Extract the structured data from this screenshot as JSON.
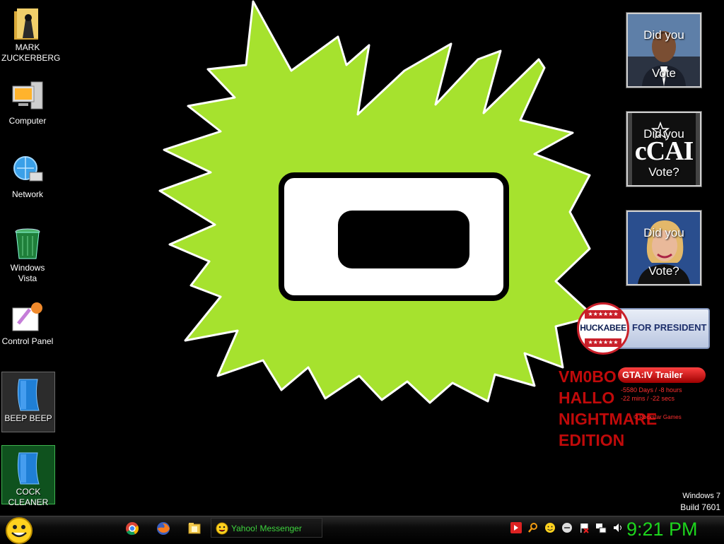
{
  "desktop_icons": [
    {
      "label": "MARK ZUCKERBERG",
      "icon": "user-folder-icon"
    },
    {
      "label": "Computer",
      "icon": "computer-icon"
    },
    {
      "label": "Network",
      "icon": "network-icon"
    },
    {
      "label": "Windows Vista",
      "icon": "recycle-bin-icon"
    },
    {
      "label": "Control Panel",
      "icon": "control-panel-icon"
    },
    {
      "label": "BEEP BEEP",
      "icon": "blue-document-icon"
    },
    {
      "label": "COCK CLEANER",
      "icon": "blue-document-icon"
    }
  ],
  "vote_gadgets": [
    {
      "line1": "Did you",
      "line2": "Vote",
      "image": "obama-photo"
    },
    {
      "line1": "Did you",
      "line2": "Vote?",
      "image": "ccai-logo",
      "logo_text": "cCAI"
    },
    {
      "line1": "Did you",
      "line2": "Vote?",
      "image": "hillary-photo"
    }
  ],
  "huckabee": {
    "name": "HUCKABEE",
    "tagline": "FOR PRESIDENT",
    "stars": "★★★★★★"
  },
  "red_text": [
    "VM0BO",
    "HALLO",
    "NIGHTMARE",
    "EDITION"
  ],
  "gta": {
    "title": "GTA:IV Trailer",
    "countdown1": "-5580 Days / -8 hours",
    "countdown2": "-22 mins / -22 secs",
    "credit": "© Rockstar Games"
  },
  "build": {
    "os": "Windows 7",
    "build": "Build 7601"
  },
  "taskbar": {
    "start_icon": "smiley-start-icon",
    "pinned": [
      "chrome-icon",
      "firefox-icon",
      "folder-icon"
    ],
    "running": {
      "label": "Yahoo! Messenger",
      "icon": "yahoo-smiley-icon"
    },
    "tray_icons": [
      "red-app-icon",
      "search-icon",
      "smiley-icon",
      "face-icon",
      "flag-icon",
      "network-icon",
      "volume-icon"
    ],
    "clock": "9:21 PM"
  },
  "colors": {
    "splat": "#a6e22e",
    "red_text": "#c00a0a",
    "clock": "#1dd51d",
    "ym_text": "#3ed43e"
  }
}
